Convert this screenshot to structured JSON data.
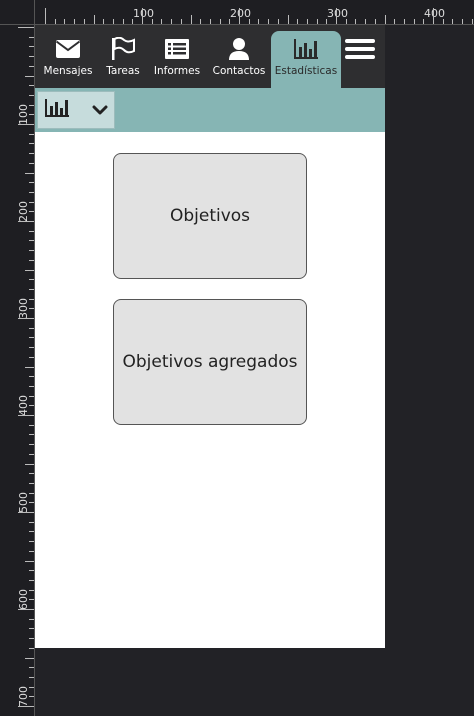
{
  "ruler": {
    "top_labels": [
      "100",
      "200",
      "300",
      "400"
    ],
    "left_labels": [
      "100",
      "200",
      "300",
      "400",
      "500",
      "600",
      "700"
    ]
  },
  "nav": {
    "tabs": [
      {
        "label": "Mensajes",
        "icon": "envelope-icon"
      },
      {
        "label": "Tareas",
        "icon": "flag-icon"
      },
      {
        "label": "Informes",
        "icon": "report-list-icon"
      },
      {
        "label": "Contactos",
        "icon": "person-icon"
      },
      {
        "label": "Estadísticas",
        "icon": "bar-chart-icon",
        "active": true
      }
    ],
    "menu_icon": "hamburger-icon"
  },
  "subbar": {
    "selector_icon": "bar-chart-icon",
    "dropdown_icon": "chevron-down-icon"
  },
  "cards": [
    {
      "label": "Objetivos"
    },
    {
      "label": "Objetivos agregados"
    }
  ],
  "colors": {
    "topbar": "#2e2e30",
    "accent": "#86b5b4",
    "card": "#e2e2e2",
    "background": "#222226"
  }
}
